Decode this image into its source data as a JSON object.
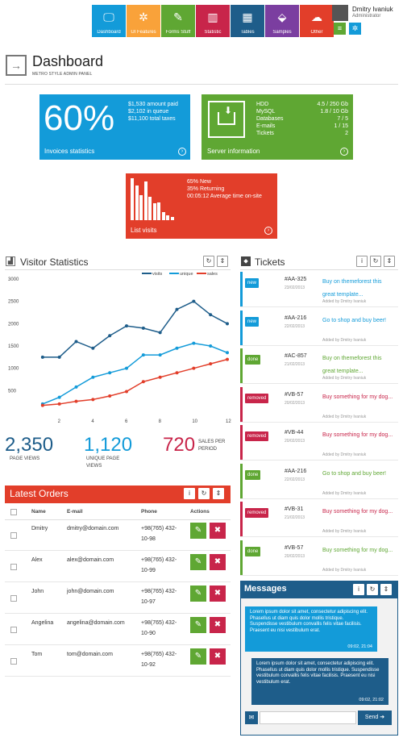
{
  "top_nav": [
    {
      "label": "Dashboard",
      "icon": "monitor-icon",
      "color": "#139bd9"
    },
    {
      "label": "UI Features",
      "icon": "gear-icon",
      "color": "#f9a23a"
    },
    {
      "label": "Forms Stuff",
      "icon": "pencil-icon",
      "color": "#5fa733"
    },
    {
      "label": "Statistic",
      "icon": "bar-chart-icon",
      "color": "#c8254a"
    },
    {
      "label": "Tables",
      "icon": "grid-icon",
      "color": "#1e5d8a"
    },
    {
      "label": "Samples",
      "icon": "box-icon",
      "color": "#7b3ea0"
    },
    {
      "label": "Other",
      "icon": "cloud-icon",
      "color": "#e23e2a"
    }
  ],
  "user": {
    "name": "Dmitry Ivaniuk",
    "role": "Administrator"
  },
  "page": {
    "title": "Dashboard",
    "subtitle": "METRO STYLE ADMIN PANEL"
  },
  "invoices": {
    "percent": "60%",
    "lines": [
      "$1,530 amount paid",
      "$2,102 in queue",
      "$11,100 total taxes"
    ],
    "label": "Invoices statistics",
    "color": "#139bd9"
  },
  "server": {
    "label": "Server information",
    "color": "#5fa733",
    "rows": [
      {
        "k": "HDD",
        "v": "4.5 / 250 Gb"
      },
      {
        "k": "MySQL",
        "v": "1.8 / 10 Gb"
      },
      {
        "k": "Databases",
        "v": "7 / 5"
      },
      {
        "k": "E-mails",
        "v": "1 / 15"
      },
      {
        "k": "Tickets",
        "v": "2"
      }
    ]
  },
  "visits": {
    "lines": [
      "65% New",
      "35% Returning",
      "00:05:12 Average time on-site"
    ],
    "label": "List visits",
    "color": "#e23e2a",
    "bars": [
      1.0,
      0.82,
      0.6,
      0.92,
      0.55,
      0.4,
      0.42,
      0.2,
      0.12,
      0.08
    ]
  },
  "visitor_stats": {
    "title": "Visitor Statistics",
    "big": [
      {
        "value": "2,350",
        "label": "PAGE VIEWS",
        "color": "#1e5d8a"
      },
      {
        "value": "1,120",
        "label": "UNIQUE PAGE VIEWS",
        "color": "#139bd9"
      },
      {
        "value": "720",
        "label": "SALES PER PERIOD",
        "color": "#c8254a"
      }
    ]
  },
  "chart_data": {
    "type": "line",
    "x": [
      0,
      1,
      2,
      3,
      4,
      5,
      6,
      7,
      8,
      9,
      10,
      11,
      12
    ],
    "series": [
      {
        "name": "visits",
        "color": "#1e5d8a",
        "values": [
          1250,
          1250,
          1600,
          1450,
          1730,
          1950,
          1900,
          1800,
          2320,
          2500,
          2200,
          2000
        ]
      },
      {
        "name": "unique",
        "color": "#139bd9",
        "values": [
          200,
          350,
          580,
          800,
          900,
          1000,
          1300,
          1300,
          1450,
          1560,
          1500,
          1350
        ]
      },
      {
        "name": "sales",
        "color": "#e23e2a",
        "values": [
          170,
          200,
          260,
          300,
          380,
          480,
          700,
          800,
          900,
          1000,
          1100,
          1200
        ]
      }
    ],
    "y_ticks": [
      500,
      1000,
      1500,
      2000,
      2500,
      3000
    ],
    "x_ticks": [
      2,
      4,
      6,
      8,
      10,
      12
    ],
    "ylim": [
      0,
      3000
    ],
    "xlim": [
      0,
      12
    ]
  },
  "tickets": {
    "title": "Tickets",
    "items": [
      {
        "badge": "new",
        "badge_color": "#139bd9",
        "id": "#AA-325",
        "date": "23/02/2013",
        "text": "Buy on themeforest this great template...",
        "text_color": "#139bd9",
        "by": "Added by Dmitry Ivaniuk"
      },
      {
        "badge": "new",
        "badge_color": "#139bd9",
        "id": "#AA-216",
        "date": "22/02/2013",
        "text": "Go to shop and buy beer!",
        "text_color": "#139bd9",
        "by": "Added by Dmitry Ivaniuk"
      },
      {
        "badge": "done",
        "badge_color": "#5fa733",
        "id": "#AC-857",
        "date": "21/02/2013",
        "text": "Buy on themeforest this great template...",
        "text_color": "#5fa733",
        "by": "Added by Dmitry Ivaniuk"
      },
      {
        "badge": "removed",
        "badge_color": "#c8254a",
        "id": "#VB-57",
        "date": "20/02/2013",
        "text": "Buy something for my dog...",
        "text_color": "#c8254a",
        "by": "Added by Dmitry Ivaniuk"
      },
      {
        "badge": "removed",
        "badge_color": "#c8254a",
        "id": "#VB-44",
        "date": "20/02/2013",
        "text": "Buy something for my dog...",
        "text_color": "#c8254a",
        "by": "Added by Dmitry Ivaniuk"
      },
      {
        "badge": "done",
        "badge_color": "#5fa733",
        "id": "#AA-216",
        "date": "22/02/2013",
        "text": "Go to shop and buy beer!",
        "text_color": "#5fa733",
        "by": "Added by Dmitry Ivaniuk"
      },
      {
        "badge": "removed",
        "badge_color": "#c8254a",
        "id": "#VB-31",
        "date": "21/02/2013",
        "text": "Buy something for my dog...",
        "text_color": "#c8254a",
        "by": "Added by Dmitry Ivaniuk"
      },
      {
        "badge": "done",
        "badge_color": "#5fa733",
        "id": "#VB-57",
        "date": "20/02/2013",
        "text": "Buy something for my dog...",
        "text_color": "#5fa733",
        "by": "Added by Dmitry Ivaniuk"
      }
    ]
  },
  "orders": {
    "title": "Latest Orders",
    "color": "#e23e2a",
    "headers": [
      "Name",
      "E-mail",
      "Phone",
      "Actions"
    ],
    "rows": [
      {
        "name": "Dmitry",
        "email": "dmitry@domain.com",
        "phone1": "+98(765) 432-",
        "phone2": "10-98"
      },
      {
        "name": "Alex",
        "email": "alex@domain.com",
        "phone1": "+98(765) 432-",
        "phone2": "10-99"
      },
      {
        "name": "John",
        "email": "john@domain.com",
        "phone1": "+98(765) 432-",
        "phone2": "10-97"
      },
      {
        "name": "Angelina",
        "email": "angelina@domain.com",
        "phone1": "+98(765) 432-",
        "phone2": "10-90"
      },
      {
        "name": "Tom",
        "email": "tom@domain.com",
        "phone1": "+98(765) 432-",
        "phone2": "10-92"
      }
    ]
  },
  "messages": {
    "title": "Messages",
    "color": "#1e5d8a",
    "items": [
      {
        "text": "Lorem ipsum dolor sit amet, consectetur adipiscing elit. Phasellus ut diam quis dolor mollis tristique. Suspendisse vestibulum convallis felis vitae facilisis. Praesent eu nisi vestibulum erat.",
        "time": "09:02, 21:04",
        "color": "#139bd9"
      },
      {
        "text": "Lorem ipsum dolor sit amet, consectetur adipiscing elit. Phasellus ut diam quis dolor mollis tristique. Suspendisse vestibulum convallis felis vitae facilisis. Praesent eu nisi vestibulum erat.",
        "time": "09:02, 21:02",
        "color": "#1e5d8a"
      }
    ],
    "send_label": "Send"
  }
}
